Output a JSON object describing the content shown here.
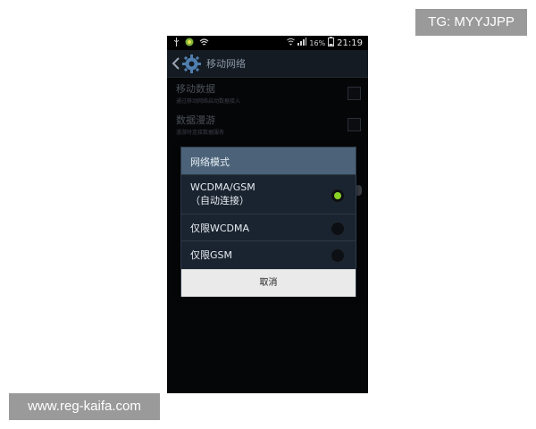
{
  "watermarks": {
    "tg": "TG: MYYJJPP",
    "site": "www.reg-kaifa.com"
  },
  "statusbar": {
    "battery_percent": "16%",
    "time": "21:19",
    "icons_left": [
      "usb-icon",
      "app-notification-icon",
      "wifi-icon"
    ],
    "icons_right": [
      "wifi-signal-icon",
      "cell-signal-icon",
      "battery-icon"
    ]
  },
  "actionbar": {
    "title": "移动网络",
    "icon": "settings-gear-icon"
  },
  "settings": [
    {
      "title": "移动数据",
      "subtitle": "通过移动网络启动数据接入"
    },
    {
      "title": "数据漫游",
      "subtitle": "漫游时连接数据服务"
    }
  ],
  "dialog": {
    "title": "网络模式",
    "options": [
      {
        "label_line1": "WCDMA/GSM",
        "label_line2": "（自动连接）",
        "selected": true
      },
      {
        "label_line1": "仅限WCDMA",
        "label_line2": "",
        "selected": false
      },
      {
        "label_line1": "仅限GSM",
        "label_line2": "",
        "selected": false
      }
    ],
    "cancel_label": "取消"
  },
  "colors": {
    "dialog_header": "#4b6278",
    "radio_selected": "#8ad126",
    "background": "#050608"
  }
}
